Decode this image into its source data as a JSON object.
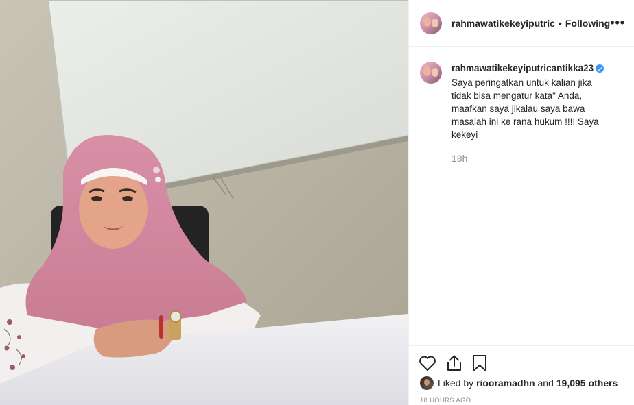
{
  "post": {
    "photo_alt": "",
    "header": {
      "username": "rahmawatikekeyiputric",
      "separator": "•",
      "follow_status": "Following",
      "more_glyph": "•••"
    },
    "caption": {
      "username": "rahmawatikekeyiputricantikka23",
      "text": "Saya peringatkan untuk kalian jika tidak bisa mengatur kata\" Anda, maafkan saya jikalau saya bawa masalah ini ke rana hukum !!!! Saya kekeyi",
      "time": "18h"
    },
    "likes": {
      "prefix": "Liked by",
      "liker": "riooramadhn",
      "joiner": "and",
      "others": "19,095 others"
    },
    "timestamp": "18 HOURS AGO"
  },
  "colors": {
    "verified_badge": "#3897f0",
    "secondary_text": "#8e8e8e",
    "primary_text": "#262626",
    "border": "#efefef"
  },
  "icons": [
    "more-icon",
    "verified-icon",
    "heart-icon",
    "share-icon",
    "bookmark-icon"
  ]
}
